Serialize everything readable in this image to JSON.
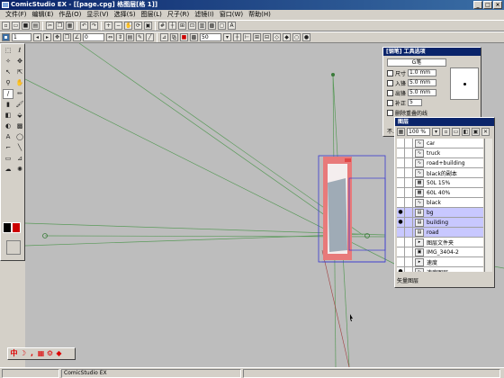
{
  "window": {
    "title": "ComicStudio EX - [[page.cpg] 格图层[格 1]]",
    "controls": [
      "_",
      "□",
      "×"
    ]
  },
  "menu": {
    "items": [
      "文件(F)",
      "编辑(E)",
      "作品(O)",
      "显示(V)",
      "选择(S)",
      "图层(L)",
      "尺子(R)",
      "滤镜(I)",
      "窗口(W)",
      "帮助(H)"
    ]
  },
  "toolbar1": {
    "zoom_value": "1",
    "field2": "0",
    "field3": "50",
    "field4": "0"
  },
  "pen_panel": {
    "title": "[钢笔] 工具选项",
    "pen_type": "G笔",
    "rows": [
      {
        "label": "尺寸",
        "value": "1.0 mm"
      },
      {
        "label": "入锋",
        "value": "5.0 mm"
      },
      {
        "label": "出锋",
        "value": "5.0 mm"
      },
      {
        "label": "补正",
        "value": "5"
      }
    ],
    "extra_rows": [
      "删除重叠的线",
      "不..."
    ]
  },
  "layers_panel": {
    "title": "图层",
    "opacity": "100 %",
    "layers": [
      {
        "name": "car",
        "type": "vec",
        "eye": false,
        "selected": false
      },
      {
        "name": "truck",
        "type": "vec",
        "eye": false,
        "selected": false
      },
      {
        "name": "road+building",
        "type": "vec",
        "eye": false,
        "selected": false
      },
      {
        "name": "black的副本",
        "type": "vec",
        "eye": false,
        "selected": false
      },
      {
        "name": "50L 15%",
        "type": "tone",
        "eye": false,
        "selected": false
      },
      {
        "name": "60L 40%",
        "type": "tone",
        "eye": false,
        "selected": false
      },
      {
        "name": "black",
        "type": "vec",
        "eye": false,
        "selected": false
      },
      {
        "name": "bg",
        "type": "raster",
        "eye": true,
        "selected": true
      },
      {
        "name": "building",
        "type": "raster",
        "eye": true,
        "selected": true
      },
      {
        "name": "road",
        "type": "raster",
        "eye": false,
        "selected": true
      },
      {
        "name": "图层文件夹",
        "type": "folder",
        "eye": false,
        "selected": false
      },
      {
        "name": "IMG_3404-2",
        "type": "img",
        "eye": false,
        "selected": false
      },
      {
        "name": "速度",
        "type": "folder",
        "eye": false,
        "selected": false
      },
      {
        "name": "速度图层",
        "type": "vec",
        "eye": true,
        "selected": false
      }
    ],
    "footer": "矢量图层"
  },
  "ime_bar": {
    "label": "中"
  },
  "statusbar": {
    "app": "ComicStudio EX"
  },
  "colors": {
    "title_bg": "#0a246a",
    "canvas_bg": "#bdbdbd",
    "selection": "#c8c8ff",
    "perspective_line": "#5a9a5a"
  }
}
